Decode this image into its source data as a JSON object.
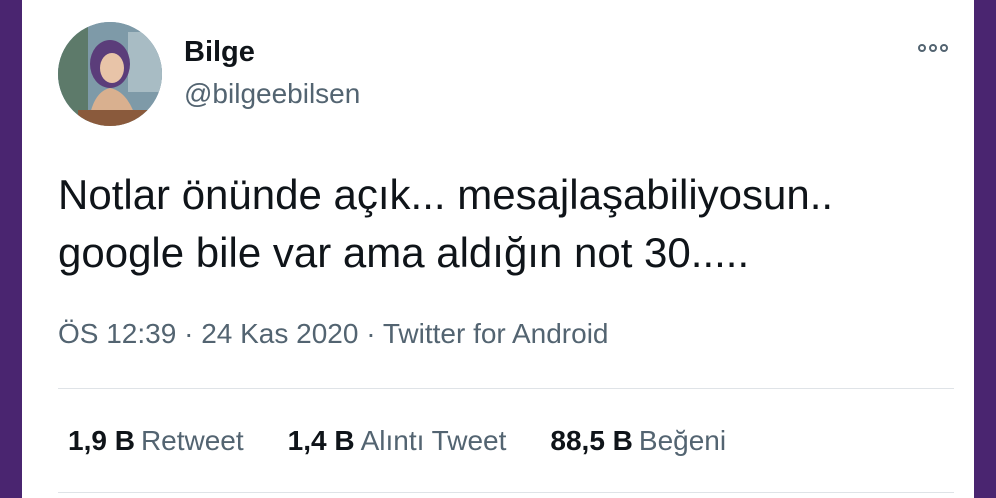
{
  "tweet": {
    "author_name": "Bilge",
    "author_handle": "@bilgeebilsen",
    "text_lines": [
      "Notlar önünde açık... mesajlaşabiliyosun..",
      "google bile var ama aldığın not 30....."
    ],
    "time": "ÖS 12:39",
    "date": "24 Kas 2020",
    "source": "Twitter for Android",
    "separator": "·"
  },
  "stats": [
    {
      "count": "1,9 B",
      "label": "Retweet"
    },
    {
      "count": "1,4 B",
      "label": "Alıntı Tweet"
    },
    {
      "count": "88,5 B",
      "label": "Beğeni"
    }
  ],
  "colors": {
    "background_frame": "#4a2570",
    "text_primary": "#0f1419",
    "text_secondary": "#536471",
    "divider": "#dfe3e7"
  },
  "icons": [
    "more-options-icon"
  ]
}
